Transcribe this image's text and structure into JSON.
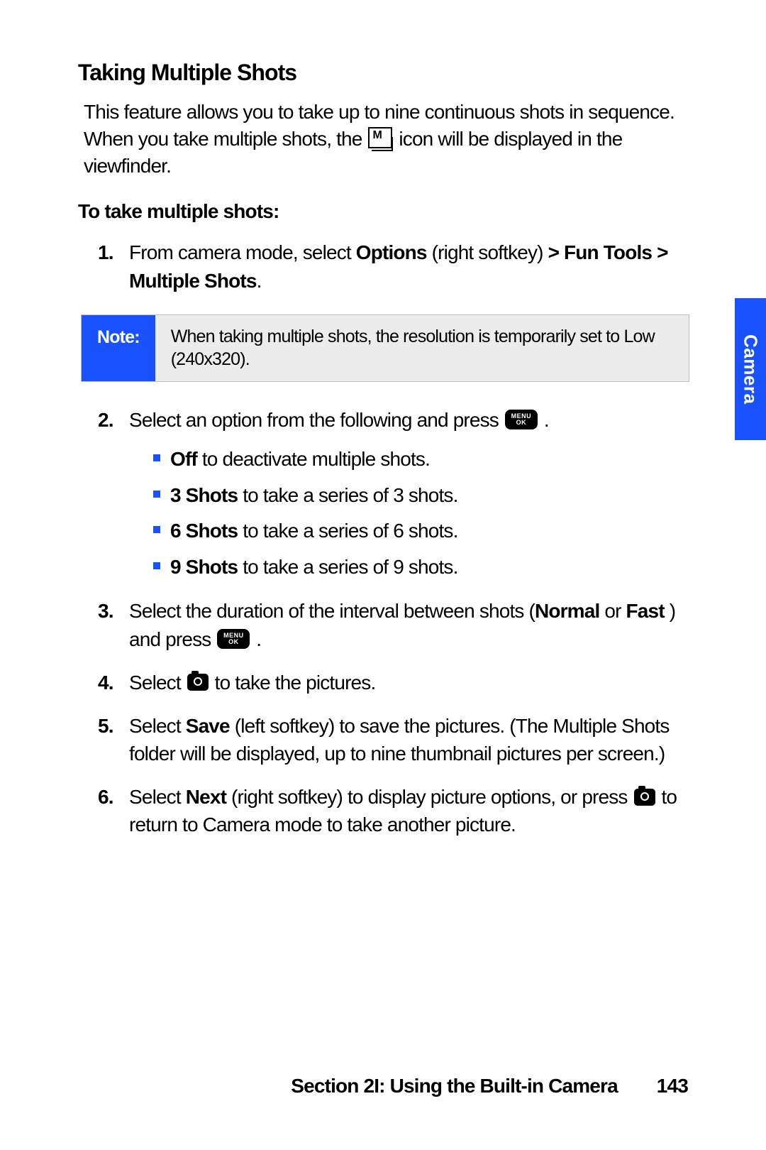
{
  "heading": "Taking Multiple Shots",
  "intro_a": "This feature allows you to take up to nine continuous shots in sequence. When you take multiple shots, the ",
  "intro_b": " icon will be displayed in the viewfinder.",
  "subhead": "To take multiple shots:",
  "step1_a": "From camera mode, select ",
  "step1_b": "Options",
  "step1_c": " (right softkey) ",
  "step1_d": "> Fun Tools > Multiple Shots",
  "step1_e": ".",
  "note_label": "Note:",
  "note_body": "When taking multiple shots, the resolution is temporarily set to Low (240x320).",
  "step2": "Select an option from the following and press ",
  "opt1_b": "Off",
  "opt1_t": " to deactivate multiple shots.",
  "opt2_b": "3 Shots",
  "opt2_t": " to take a series of 3 shots.",
  "opt3_b": "6 Shots",
  "opt3_t": " to take a series of 6 shots.",
  "opt4_b": "9 Shots",
  "opt4_t": " to take a series of 9 shots.",
  "step3_a": "Select the duration of the interval between shots (",
  "step3_b": "Normal",
  "step3_c": " or ",
  "step3_d": "Fast",
  "step3_e": " ) and press ",
  "step4_a": "Select ",
  "step4_b": " to take the pictures.",
  "step5_a": "Select ",
  "step5_b": "Save",
  "step5_c": " (left softkey) to save the pictures. (The Multiple Shots folder will be displayed, up to nine thumbnail pictures per screen.)",
  "step6_a": "Select ",
  "step6_b": "Next",
  "step6_c": " (right softkey) to display picture options, or press ",
  "step6_d": " to return to Camera mode to take another picture.",
  "side_tab": "Camera",
  "footer_section": "Section 2I: Using the Built-in Camera",
  "page_number": "143",
  "menu_top": "MENU",
  "menu_bot": "OK"
}
